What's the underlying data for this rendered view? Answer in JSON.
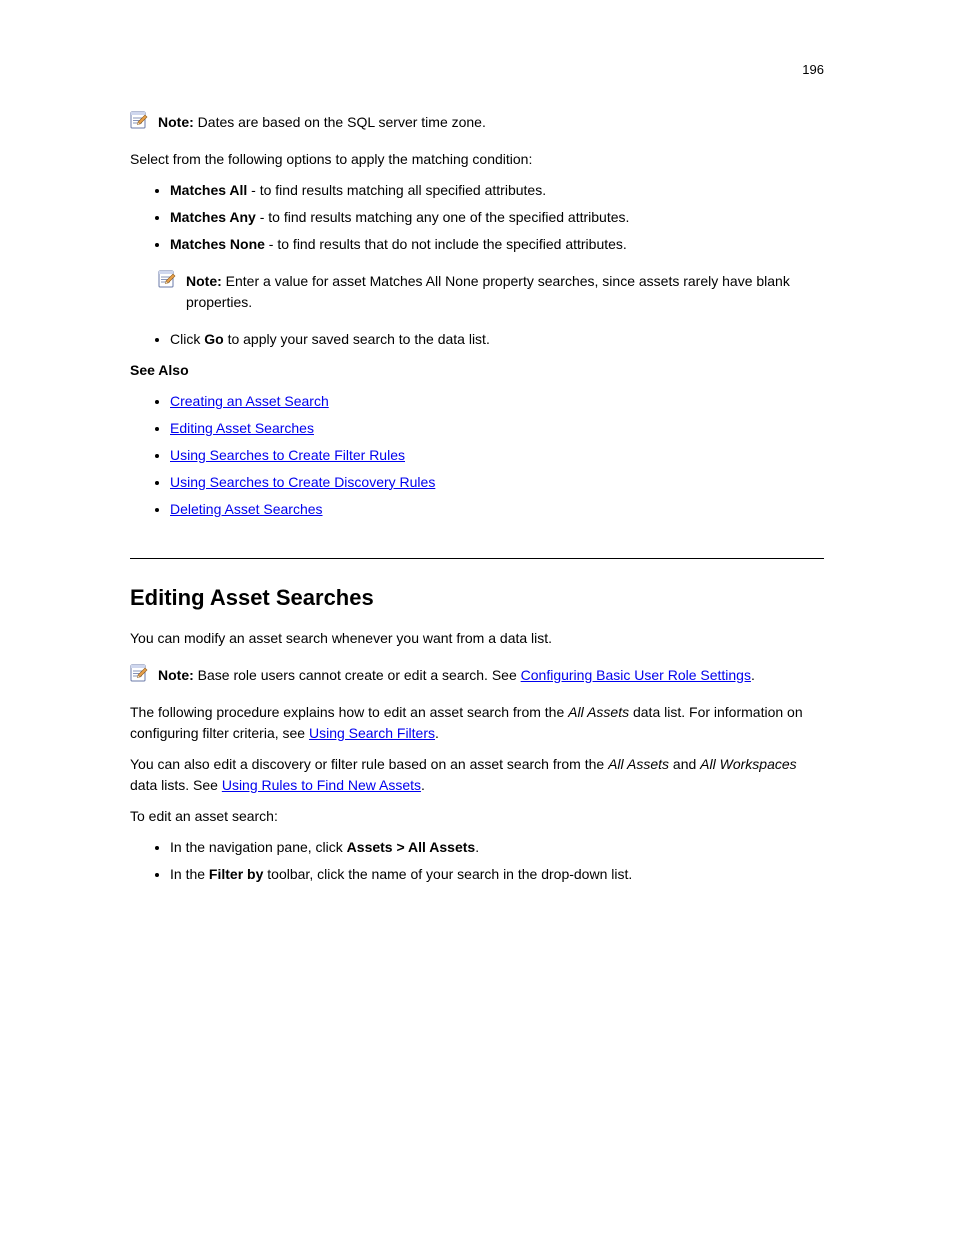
{
  "page_number": "196",
  "note1": {
    "label": "Note:",
    "text": "Dates are based on the SQL server time zone."
  },
  "options_intro": "Select from the following options to apply the matching condition:",
  "options": [
    {
      "label": "Matches All",
      "desc": " - to find results matching all specified attributes."
    },
    {
      "label": "Matches Any",
      "desc": " - to find results matching any one of the specified attributes."
    },
    {
      "label": "Matches None",
      "desc": " - to find results that do not include the specified attributes."
    }
  ],
  "note2": {
    "label": "Note:",
    "text": "Enter a value for asset Matches All None property searches, since assets rarely have blank properties."
  },
  "click": {
    "pre": "Click ",
    "btn": "Go",
    "post": " to apply your saved search to the data list."
  },
  "see_also": "See Also",
  "see_links": [
    "Creating an Asset Search",
    "Editing Asset Searches",
    "Using Searches to Create Filter Rules",
    "Using Searches to Create Discovery Rules",
    "Deleting Asset Searches"
  ],
  "section_title": "Editing Asset Searches",
  "edit_intro": "You can modify an asset search whenever you want from a data list.",
  "note3": {
    "label": "Note:",
    "text_pre": "Base role users cannot create or edit a search. See ",
    "link": "Configuring Basic User Role Settings",
    "text_post": "."
  },
  "p1": {
    "pre": "The following procedure explains how to edit an asset search from the ",
    "italic1": "All Assets",
    "mid": " data list. For information on configuring filter criteria, see ",
    "link": "Using Search Filters",
    "post": "."
  },
  "p2": {
    "pre": "You can also edit a discovery or filter rule based on an asset search from the ",
    "italic1": "All Assets",
    "mid": " and ",
    "italic2": "All Workspaces",
    "mid2": " data lists. See ",
    "link": "Using Rules to Find New Assets",
    "post": "."
  },
  "steps_intro": "To edit an asset search:",
  "steps": [
    {
      "pre": "In the navigation pane, click ",
      "bold": "Assets > All Assets",
      "post": "."
    },
    {
      "pre": "In the ",
      "bold": "Filter by",
      "post": " toolbar, click the name of your search in the drop-down list."
    }
  ]
}
